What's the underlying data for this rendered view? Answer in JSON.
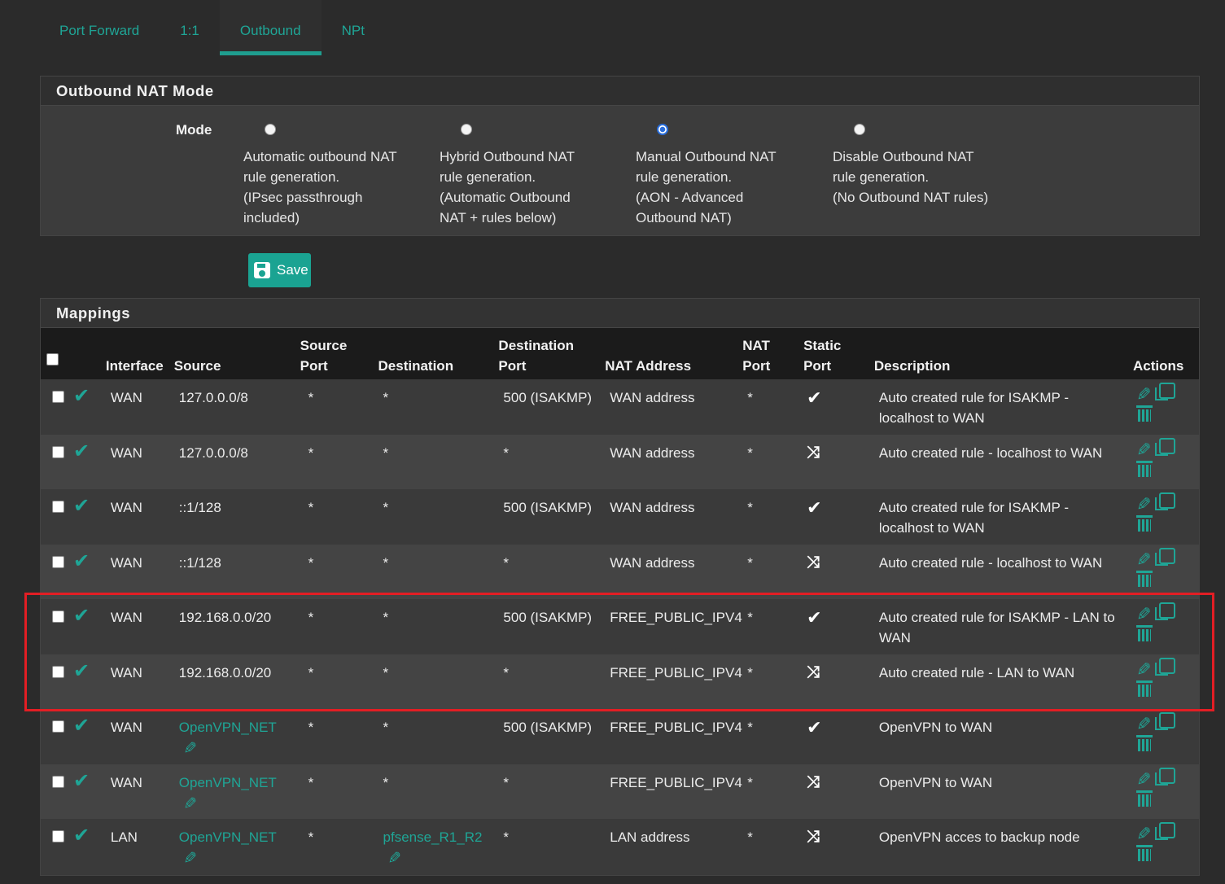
{
  "tabs": [
    "Port Forward",
    "1:1",
    "Outbound",
    "NPt"
  ],
  "active_tab": "Outbound",
  "mode_panel": {
    "title": "Outbound NAT Mode",
    "mode_label": "Mode",
    "options": [
      {
        "lines": [
          "Automatic outbound NAT",
          "rule generation.",
          "(IPsec passthrough",
          "included)"
        ],
        "checked": false
      },
      {
        "lines": [
          "Hybrid Outbound NAT",
          "rule generation.",
          "(Automatic Outbound",
          "NAT + rules below)"
        ],
        "checked": false
      },
      {
        "lines": [
          "Manual Outbound NAT",
          "rule generation.",
          "(AON - Advanced",
          "Outbound NAT)"
        ],
        "checked": true
      },
      {
        "lines": [
          "Disable Outbound NAT",
          "rule generation.",
          "(No Outbound NAT rules)"
        ],
        "checked": false
      }
    ]
  },
  "save_label": "Save",
  "mappings": {
    "title": "Mappings",
    "headers": {
      "interface": "Interface",
      "source": "Source",
      "source_port": [
        "Source",
        "Port"
      ],
      "destination": "Destination",
      "destination_port": [
        "Destination",
        "Port"
      ],
      "nat_address": "NAT Address",
      "nat_port": [
        "NAT",
        "Port"
      ],
      "static_port": [
        "Static",
        "Port"
      ],
      "description": "Description",
      "actions": "Actions"
    },
    "rows": [
      {
        "interface": "WAN",
        "source": "127.0.0.0/8",
        "source_alias": false,
        "source_port": "*",
        "destination": "*",
        "destination_alias": false,
        "destination_port": "500 (ISAKMP)",
        "nat_address": "WAN address",
        "nat_port": "*",
        "static": "check",
        "description": "Auto created rule for ISAKMP - localhost to WAN"
      },
      {
        "interface": "WAN",
        "source": "127.0.0.0/8",
        "source_alias": false,
        "source_port": "*",
        "destination": "*",
        "destination_alias": false,
        "destination_port": "*",
        "nat_address": "WAN address",
        "nat_port": "*",
        "static": "shuffle",
        "description": "Auto created rule - localhost to WAN"
      },
      {
        "interface": "WAN",
        "source": "::1/128",
        "source_alias": false,
        "source_port": "*",
        "destination": "*",
        "destination_alias": false,
        "destination_port": "500 (ISAKMP)",
        "nat_address": "WAN address",
        "nat_port": "*",
        "static": "check",
        "description": "Auto created rule for ISAKMP - localhost to WAN"
      },
      {
        "interface": "WAN",
        "source": "::1/128",
        "source_alias": false,
        "source_port": "*",
        "destination": "*",
        "destination_alias": false,
        "destination_port": "*",
        "nat_address": "WAN address",
        "nat_port": "*",
        "static": "shuffle",
        "description": "Auto created rule - localhost to WAN"
      },
      {
        "interface": "WAN",
        "source": "192.168.0.0/20",
        "source_alias": false,
        "source_port": "*",
        "destination": "*",
        "destination_alias": false,
        "destination_port": "500 (ISAKMP)",
        "nat_address": "FREE_PUBLIC_IPV4",
        "nat_port": "*",
        "static": "check",
        "description": "Auto created rule for ISAKMP - LAN to WAN"
      },
      {
        "interface": "WAN",
        "source": "192.168.0.0/20",
        "source_alias": false,
        "source_port": "*",
        "destination": "*",
        "destination_alias": false,
        "destination_port": "*",
        "nat_address": "FREE_PUBLIC_IPV4",
        "nat_port": "*",
        "static": "shuffle",
        "description": "Auto created rule - LAN to WAN"
      },
      {
        "interface": "WAN",
        "source": "OpenVPN_NET",
        "source_alias": true,
        "source_port": "*",
        "destination": "*",
        "destination_alias": false,
        "destination_port": "500 (ISAKMP)",
        "nat_address": "FREE_PUBLIC_IPV4",
        "nat_port": "*",
        "static": "check",
        "description": "OpenVPN to WAN"
      },
      {
        "interface": "WAN",
        "source": "OpenVPN_NET",
        "source_alias": true,
        "source_port": "*",
        "destination": "*",
        "destination_alias": false,
        "destination_port": "*",
        "nat_address": "FREE_PUBLIC_IPV4",
        "nat_port": "*",
        "static": "shuffle",
        "description": "OpenVPN to WAN"
      },
      {
        "interface": "LAN",
        "source": "OpenVPN_NET",
        "source_alias": true,
        "source_port": "*",
        "destination": "pfsense_R1_R2",
        "destination_alias": true,
        "destination_port": "*",
        "nat_address": "LAN address",
        "nat_port": "*",
        "static": "shuffle",
        "description": "OpenVPN acces to backup node"
      }
    ]
  },
  "colors": {
    "accent": "#1fa596",
    "highlight_box": "#e31e24",
    "radio_selected": "#2a6edb"
  }
}
